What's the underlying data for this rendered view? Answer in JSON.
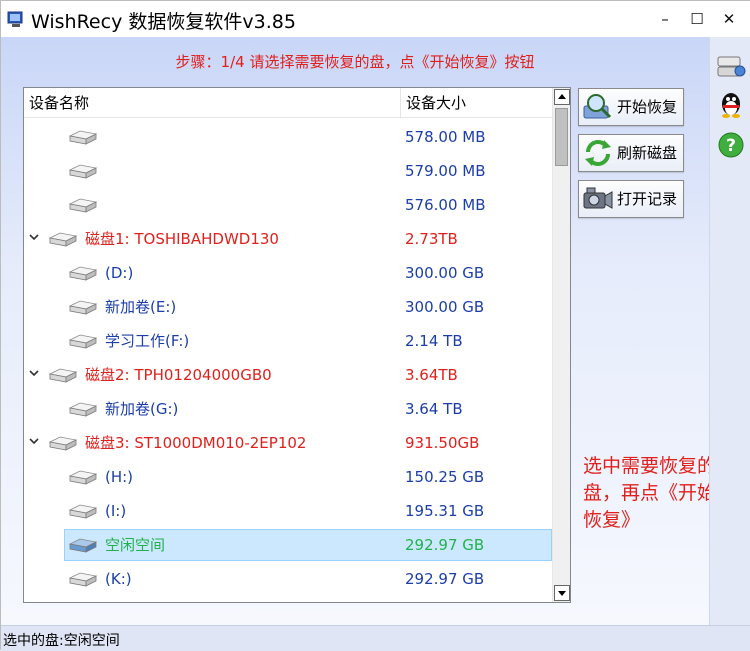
{
  "window": {
    "title": "WishRecy 数据恢复软件v3.85",
    "minimize_glyph": "–",
    "maximize_glyph": "☐",
    "close_glyph": "✕"
  },
  "step_text": "步骤：1/4 请选择需要恢复的盘，点《开始恢复》按钮",
  "list": {
    "headers": {
      "name": "设备名称",
      "size": "设备大小"
    },
    "rows": [
      {
        "level": 2,
        "expander": false,
        "name": "",
        "size": "578.00 MB",
        "color": "#1c3ea8",
        "selected": false,
        "disk": false
      },
      {
        "level": 2,
        "expander": false,
        "name": "",
        "size": "579.00 MB",
        "color": "#1c3ea8",
        "selected": false,
        "disk": false
      },
      {
        "level": 2,
        "expander": false,
        "name": "",
        "size": "576.00 MB",
        "color": "#1c3ea8",
        "selected": false,
        "disk": false
      },
      {
        "level": 1,
        "expander": true,
        "name": "磁盘1: TOSHIBAHDWD130",
        "size": "2.73TB",
        "color": "#e0201c",
        "selected": false,
        "disk": true
      },
      {
        "level": 2,
        "expander": false,
        "name": "(D:)",
        "size": "300.00 GB",
        "color": "#1c3ea8",
        "selected": false,
        "disk": false
      },
      {
        "level": 2,
        "expander": false,
        "name": "新加卷(E:)",
        "size": "300.00 GB",
        "color": "#1c3ea8",
        "selected": false,
        "disk": false
      },
      {
        "level": 2,
        "expander": false,
        "name": "学习工作(F:)",
        "size": "2.14 TB",
        "color": "#1c3ea8",
        "selected": false,
        "disk": false
      },
      {
        "level": 1,
        "expander": true,
        "name": "磁盘2: TPH01204000GB0",
        "size": "3.64TB",
        "color": "#e0201c",
        "selected": false,
        "disk": true
      },
      {
        "level": 2,
        "expander": false,
        "name": "新加卷(G:)",
        "size": "3.64 TB",
        "color": "#1c3ea8",
        "selected": false,
        "disk": false
      },
      {
        "level": 1,
        "expander": true,
        "name": "磁盘3: ST1000DM010-2EP102",
        "size": "931.50GB",
        "color": "#e0201c",
        "selected": false,
        "disk": true
      },
      {
        "level": 2,
        "expander": false,
        "name": "(H:)",
        "size": "150.25 GB",
        "color": "#1c3ea8",
        "selected": false,
        "disk": false
      },
      {
        "level": 2,
        "expander": false,
        "name": "(I:)",
        "size": "195.31 GB",
        "color": "#1c3ea8",
        "selected": false,
        "disk": false
      },
      {
        "level": 2,
        "expander": false,
        "name": "空闲空间",
        "size": "292.97 GB",
        "color": "#22b14c",
        "selected": true,
        "disk": false
      },
      {
        "level": 2,
        "expander": false,
        "name": "(K:)",
        "size": "292.97 GB",
        "color": "#1c3ea8",
        "selected": false,
        "disk": false
      }
    ]
  },
  "buttons": {
    "start": {
      "label": "开始恢复",
      "icon": "magnifier-disk-icon"
    },
    "refresh": {
      "label": "刷新磁盘",
      "icon": "refresh-arrows-icon"
    },
    "log": {
      "label": "打开记录",
      "icon": "camera-log-icon"
    }
  },
  "hint_text": "选中需要恢复的盘，再点《开始恢复》",
  "status_text": "选中的盘:空闲空间",
  "side_icons": [
    "network-drives-icon",
    "qq-penguin-icon",
    "help-question-icon"
  ],
  "colors": {
    "accent_red": "#e0201c",
    "drive_blue": "#1c3ea8",
    "free_green": "#22b14c",
    "selection": "#cce8ff"
  }
}
